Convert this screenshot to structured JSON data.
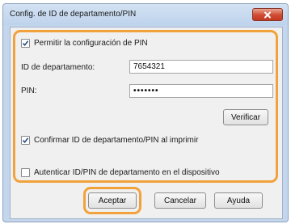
{
  "window": {
    "title": "Config. de ID de departamento/PIN"
  },
  "options": {
    "allow_pin": {
      "label": "Permitir la configuración de PIN",
      "checked": true
    },
    "confirm_print": {
      "label": "Confirmar ID de departamento/PIN al imprimir",
      "checked": true
    },
    "authenticate_device": {
      "label": "Autenticar ID/PIN de departamento en el dispositivo",
      "checked": false
    }
  },
  "fields": {
    "department_id": {
      "label": "ID de departamento:",
      "value": "7654321"
    },
    "pin": {
      "label": "PIN:",
      "value": "•••••••"
    }
  },
  "buttons": {
    "verify": "Verificar",
    "accept": "Aceptar",
    "cancel": "Cancelar",
    "help": "Ayuda"
  },
  "icons": {
    "close": "close-icon",
    "check": "checkmark-icon"
  },
  "colors": {
    "highlight": "#f2a23a",
    "close_button": "#cf4a31"
  }
}
